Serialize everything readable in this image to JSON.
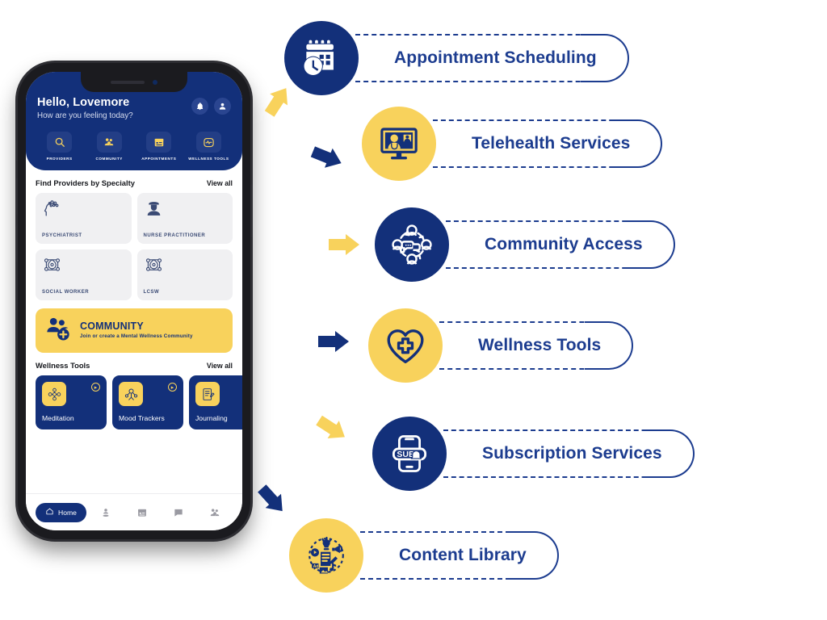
{
  "colors": {
    "navy": "#13307a",
    "gold": "#f8d25c",
    "pill_border": "#1c3c8f",
    "card_bg": "#f0f0f2"
  },
  "phone": {
    "header": {
      "greeting": "Hello, Lovemore",
      "subtitle": "How are you feeling today?",
      "bell_icon": "bell-icon",
      "profile_icon": "user-icon"
    },
    "quick_actions": [
      {
        "label": "PROVIDERS",
        "icon": "search-icon"
      },
      {
        "label": "COMMUNITY",
        "icon": "community-group-icon"
      },
      {
        "label": "APPOINTMENTS",
        "icon": "calendar-icon"
      },
      {
        "label": "WELLNESS TOOLS",
        "icon": "pulse-icon"
      }
    ],
    "specialty_section": {
      "title": "Find Providers by Specialty",
      "view_all": "View all",
      "cards": [
        {
          "label": "PSYCHIATRIST",
          "icon": "brain-head-icon"
        },
        {
          "label": "NURSE PRACTITIONER",
          "icon": "nurse-icon"
        },
        {
          "label": "SOCIAL WORKER",
          "icon": "support-network-icon"
        },
        {
          "label": "LCSW",
          "icon": "support-network-icon"
        }
      ]
    },
    "community_banner": {
      "title": "COMMUNITY",
      "subtitle": "Join or create a Mental Wellness Community",
      "icon": "community-add-icon"
    },
    "wellness_section": {
      "title": "Wellness Tools",
      "view_all": "View all",
      "cards": [
        {
          "label": "Meditation",
          "icon": "meditation-icon",
          "arrow": "chevron-right-icon"
        },
        {
          "label": "Mood Trackers",
          "icon": "mood-tracker-icon",
          "arrow": "chevron-right-icon"
        },
        {
          "label": "Journaling",
          "icon": "journal-icon",
          "arrow": "chevron-right-icon"
        }
      ]
    },
    "tabbar": {
      "home_label": "Home",
      "items": [
        {
          "icon": "home-icon",
          "label": "Home",
          "active": true
        },
        {
          "icon": "person-pin-icon",
          "label": "",
          "active": false
        },
        {
          "icon": "calendar-icon",
          "label": "",
          "active": false
        },
        {
          "icon": "chat-icon",
          "label": "",
          "active": false
        },
        {
          "icon": "group-icon",
          "label": "",
          "active": false
        }
      ]
    }
  },
  "features": [
    {
      "label": "Appointment Scheduling",
      "icon": "calendar-clock-icon",
      "circle_color": "navy",
      "arrow_color": "gold"
    },
    {
      "label": "Telehealth Services",
      "icon": "telehealth-monitor-icon",
      "circle_color": "gold",
      "arrow_color": "navy"
    },
    {
      "label": "Community Access",
      "icon": "community-network-icon",
      "circle_color": "navy",
      "arrow_color": "gold"
    },
    {
      "label": "Wellness Tools",
      "icon": "heart-cross-icon",
      "circle_color": "gold",
      "arrow_color": "navy"
    },
    {
      "label": "Subscription Services",
      "icon": "subscribe-phone-icon",
      "circle_color": "navy",
      "arrow_color": "gold"
    },
    {
      "label": "Content Library",
      "icon": "content-library-icon",
      "circle_color": "gold",
      "arrow_color": "navy"
    }
  ]
}
